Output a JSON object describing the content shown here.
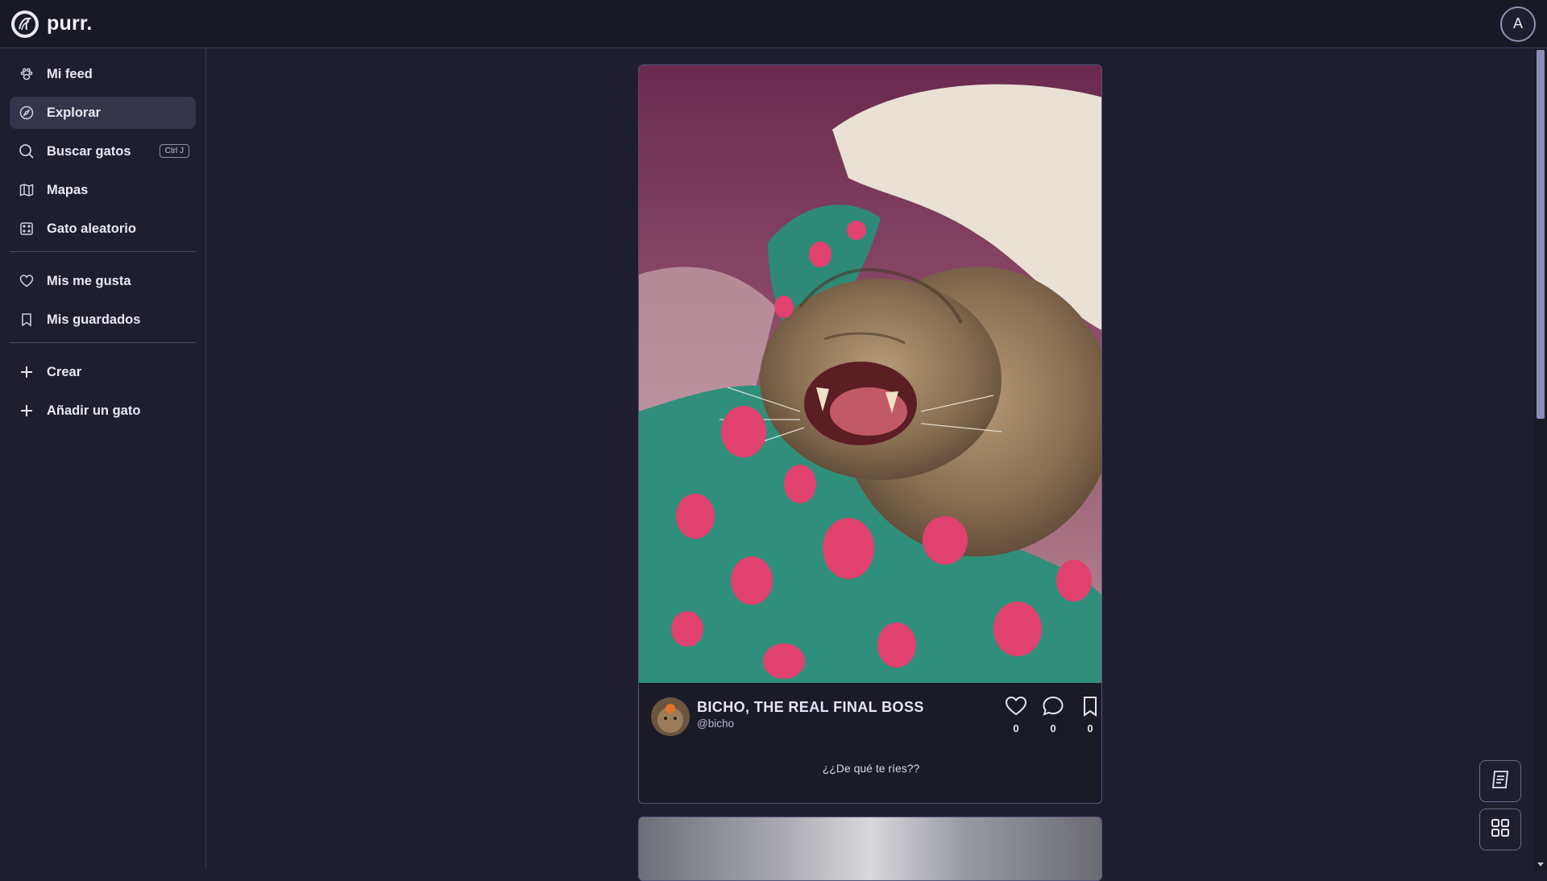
{
  "app": {
    "name": "purr.",
    "avatar_initial": "A"
  },
  "sidebar": {
    "items": [
      {
        "label": "Mi feed",
        "icon": "paw-icon"
      },
      {
        "label": "Explorar",
        "icon": "compass-icon",
        "active": true
      },
      {
        "label": "Buscar gatos",
        "icon": "search-icon",
        "shortcut": "Ctrl J"
      },
      {
        "label": "Mapas",
        "icon": "map-icon"
      },
      {
        "label": "Gato aleatorio",
        "icon": "dice-icon"
      },
      {
        "label": "Mis me gusta",
        "icon": "heart-icon"
      },
      {
        "label": "Mis guardados",
        "icon": "bookmark-icon"
      },
      {
        "label": "Crear",
        "icon": "plus-icon"
      },
      {
        "label": "Añadir un gato",
        "icon": "plus-icon"
      }
    ]
  },
  "post": {
    "author_name": "BICHO, THE REAL FINAL BOSS",
    "author_handle": "@bicho",
    "likes": "0",
    "comments": "0",
    "saves": "0",
    "caption": "¿¿De qué te ríes??"
  },
  "colors": {
    "background": "#1e1e2e",
    "active_item": "#34344b",
    "scroll_thumb": "#8c8cb8"
  }
}
